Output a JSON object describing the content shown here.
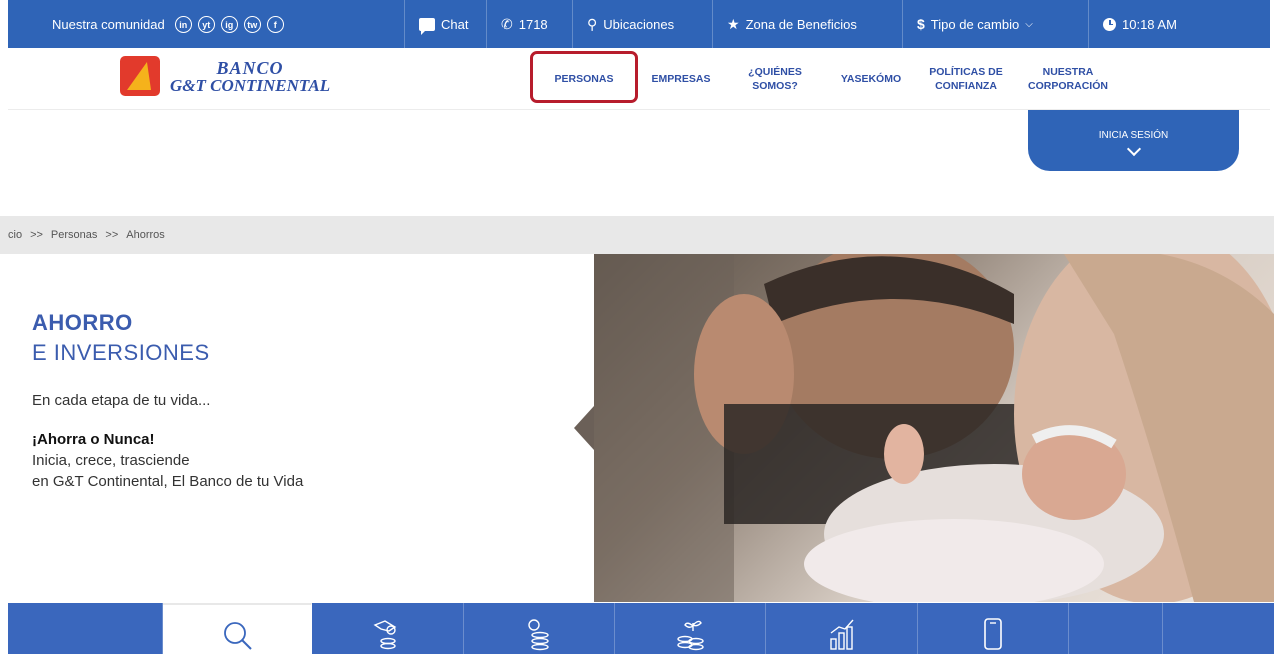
{
  "topbar": {
    "community_label": "Nuestra comunidad",
    "social_icons": [
      "in",
      "yt",
      "ig",
      "tw",
      "f"
    ],
    "chat_label": "Chat",
    "phone_label": "1718",
    "locations_label": "Ubicaciones",
    "benefits_label": "Zona de Beneficios",
    "exchange_label": "Tipo de cambio",
    "time_label": "10:18 AM"
  },
  "logo": {
    "line1": "BANCO",
    "line2": "G&T CONTINENTAL"
  },
  "nav": {
    "items": [
      {
        "label": "PERSONAS"
      },
      {
        "label": "EMPRESAS"
      },
      {
        "label": "¿QUIÉNES\nSOMOS?"
      },
      {
        "label": "YASEKÓMO"
      },
      {
        "label": "POLÍTICAS DE\nCONFIANZA"
      },
      {
        "label": "NUESTRA\nCORPORACIÓN"
      }
    ]
  },
  "login": {
    "label": "INICIA SESIÓN"
  },
  "breadcrumb": {
    "items": [
      "cio",
      ">>",
      "Personas",
      ">>",
      "Ahorros"
    ]
  },
  "hero": {
    "title": "AHORRO",
    "subtitle": "E INVERSIONES",
    "tagline": "En cada etapa de tu vida...",
    "bold_line": "¡Ahorra o Nunca!",
    "line1": "Inicia, crece, trasciende",
    "line2": "en G&T Continental, El Banco de tu Vida"
  },
  "tab_icons": [
    "search-icon",
    "hand-coins-icon",
    "coin-stack-icon",
    "plant-coins-icon",
    "growth-chart-icon",
    "mobile-phone-icon"
  ],
  "colors": {
    "primary_blue": "#2f64b7",
    "brand_text_blue": "#2f4fa5",
    "highlight_red": "#b71c2c",
    "logo_red": "#e23a2c",
    "logo_yellow": "#f5b21b"
  }
}
